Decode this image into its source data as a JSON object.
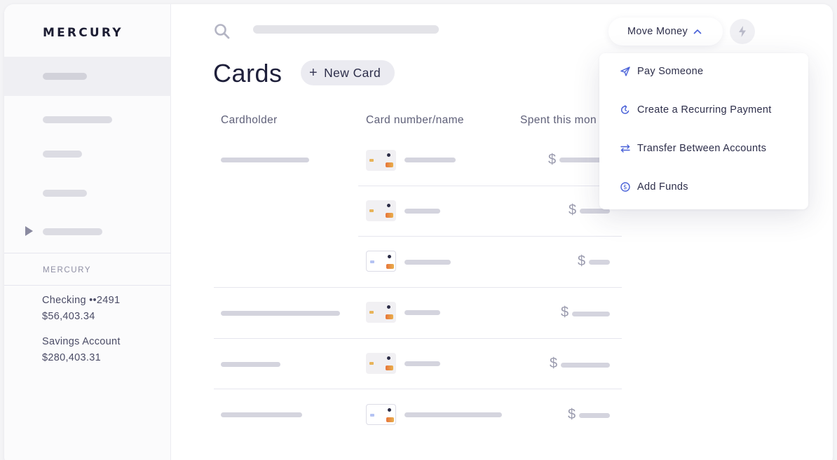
{
  "sidebar": {
    "logo": "MERCURY",
    "section_label": "MERCURY",
    "accounts": [
      {
        "name": "Checking ••2491",
        "balance": "$56,403.34"
      },
      {
        "name": "Savings Account",
        "balance": "$280,403.31"
      }
    ]
  },
  "header": {
    "title": "Cards",
    "new_card_label": "New Card",
    "move_money_label": "Move Money"
  },
  "table": {
    "columns": [
      "Cardholder",
      "Card number/name",
      "Spent this mon"
    ],
    "currency_symbol": "$"
  },
  "dropdown": {
    "items": [
      {
        "label": "Pay Someone",
        "icon": "paper-plane-icon"
      },
      {
        "label": "Create a Recurring Payment",
        "icon": "recurring-icon"
      },
      {
        "label": "Transfer Between Accounts",
        "icon": "transfer-arrows-icon"
      },
      {
        "label": "Add Funds",
        "icon": "dollar-coin-icon"
      }
    ]
  },
  "colors": {
    "accent": "#4a62d8",
    "text": "#1e1f3a",
    "placeholder_bar": "#d6d6df"
  }
}
